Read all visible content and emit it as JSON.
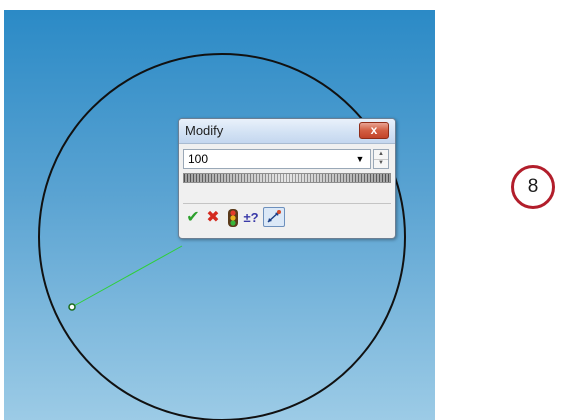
{
  "modify_dialog": {
    "title": "Modify",
    "close_label": "x",
    "value": "100",
    "toolbar": {
      "ok_icon": "checkmark-icon",
      "cancel_icon": "x-icon",
      "rebuild_icon": "traffic-light-icon",
      "tolerance_icon": "plus-minus-question-icon",
      "mark_dimension_icon": "mark-dimension-icon"
    }
  },
  "badge": {
    "label": "8"
  },
  "colors": {
    "viewport_top": "#2b8ac6",
    "viewport_bottom": "#9ccbe6",
    "sketch_circle": "#111111",
    "radius_preview_line": "#2fcf3a",
    "badge_ring": "#b21e2b"
  }
}
